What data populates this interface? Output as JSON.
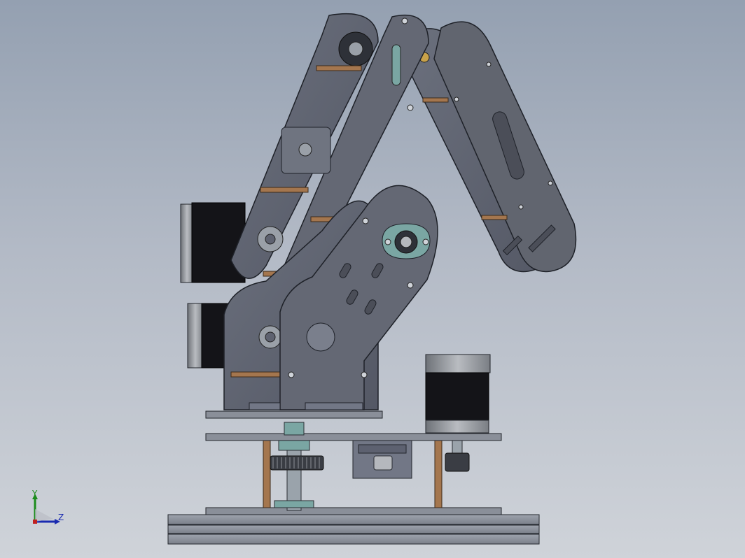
{
  "viewport": {
    "background_top": "#94a0b1",
    "background_bottom": "#cfd3d9",
    "part_color": "#5e6270",
    "part_edge": "#1e2128",
    "standoff_color": "#a4764e",
    "motor_body": "#141418",
    "motor_cap": "#8e9298",
    "bearing_color": "#7aa6a3"
  },
  "triad": {
    "y_label": "Y",
    "z_label": "Z",
    "y_color": "#1c8c1c",
    "z_color": "#1a2ab0"
  }
}
